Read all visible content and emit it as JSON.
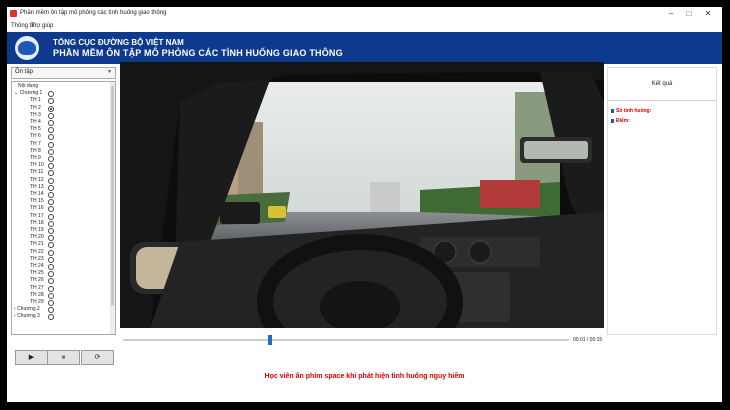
{
  "window": {
    "title": "Phần mềm ôn tập mô phỏng các tình huống giao thông"
  },
  "menu": [
    {
      "label": "Thông tin"
    },
    {
      "label": "Trợ giúp"
    }
  ],
  "banner": {
    "line1": "TỔNG CỤC ĐƯỜNG BỘ VIỆT NAM",
    "line2": "PHẦN MỀM ÔN TẬP MÔ PHỎNG CÁC TÌNH HUỐNG GIAO THÔNG"
  },
  "sidebar": {
    "mode": "Ôn tập",
    "root_label": "Nội dung",
    "chapter1": {
      "label": "Chương 1",
      "expanded": true
    },
    "items": [
      "TH 1",
      "TH 2",
      "TH 3",
      "TH 4",
      "TH 5",
      "TH 6",
      "TH 7",
      "TH 8",
      "TH 9",
      "TH 10",
      "TH 11",
      "TH 12",
      "TH 13",
      "TH 14",
      "TH 15",
      "TH 16",
      "TH 17",
      "TH 18",
      "TH 19",
      "TH 20",
      "TH 21",
      "TH 22",
      "TH 23",
      "TH 24",
      "TH 25",
      "TH 26",
      "TH 27",
      "TH 28",
      "TH 29"
    ],
    "selected_index": 1,
    "other_chapters": [
      {
        "label": "Chương 2"
      },
      {
        "label": "Chương 3"
      }
    ]
  },
  "result": {
    "title": "Kết quả",
    "situations_label": "Số tình huống:",
    "score_label": "Điểm:"
  },
  "player": {
    "time_display": "00:01 / 00:15",
    "progress": 0.33,
    "buttons": [
      {
        "icon": "play-icon"
      },
      {
        "icon": "pause-icon"
      },
      {
        "icon": "replay-icon"
      }
    ]
  },
  "notice": "Học viên ấn phím space khi phát hiện tình huống nguy hiểm",
  "colors": {
    "banner": "#0d3a8c",
    "accent": "#1d6fc4",
    "alert": "#d00000"
  }
}
